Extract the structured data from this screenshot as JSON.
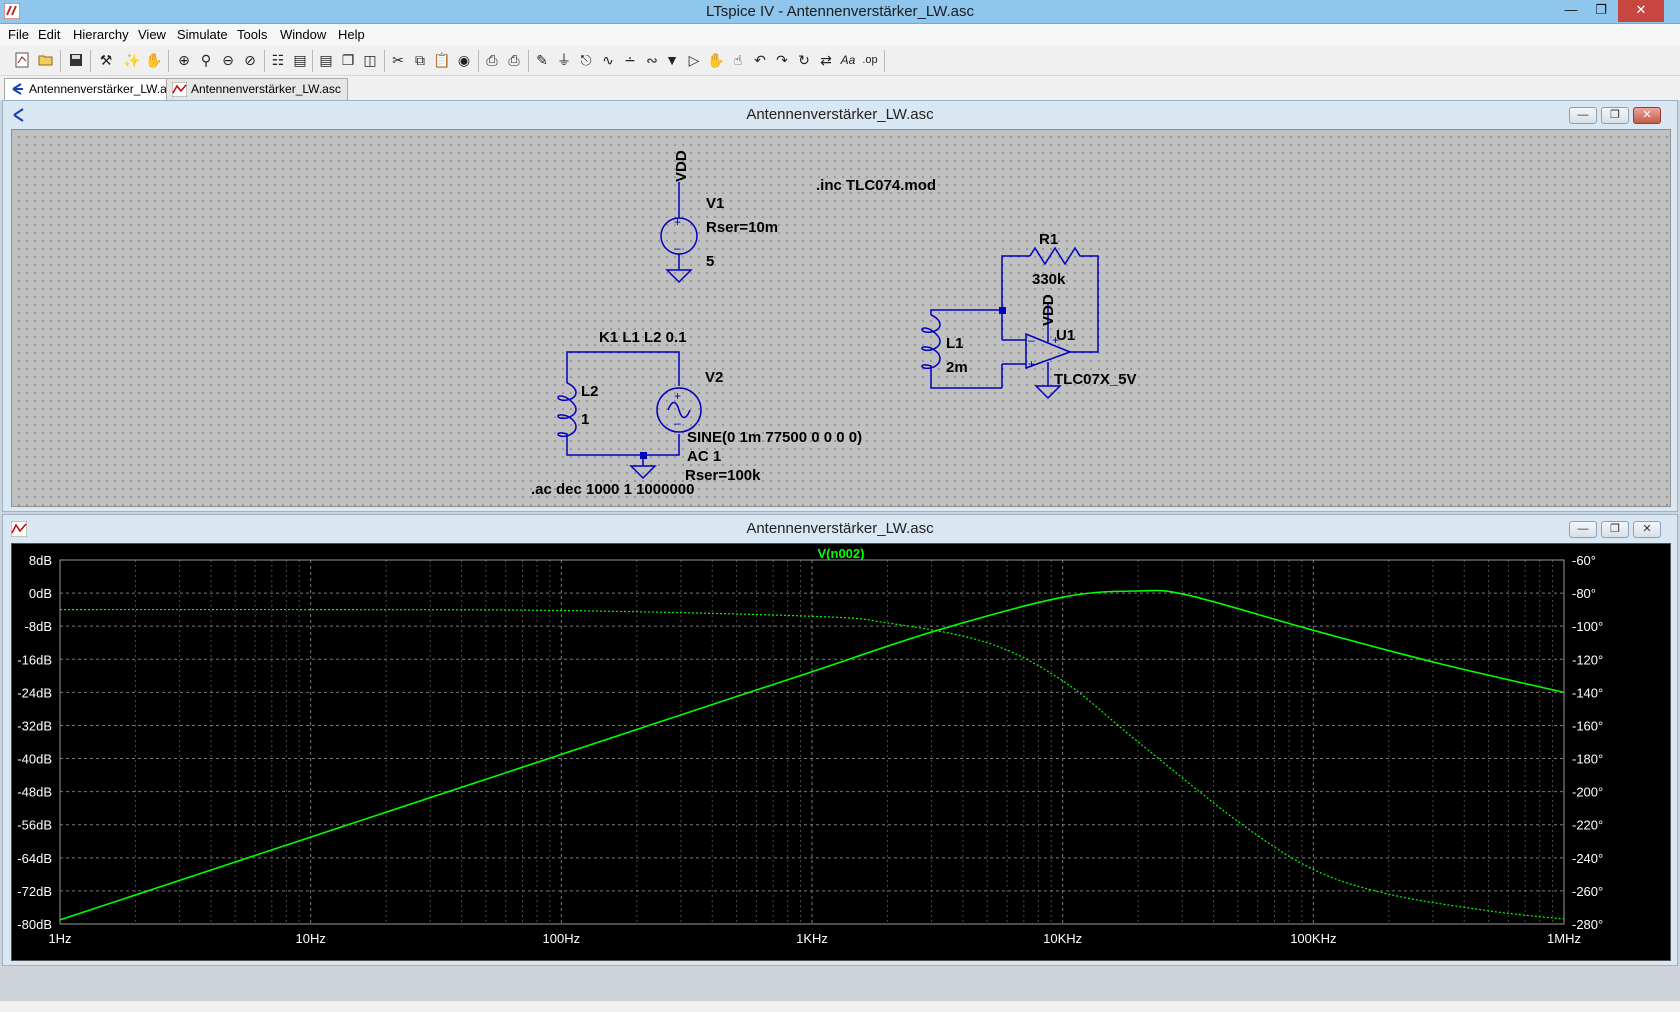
{
  "window": {
    "title": "LTspice IV - Antennenverstärker_LW.asc"
  },
  "menu": [
    "File",
    "Edit",
    "Hierarchy",
    "View",
    "Simulate",
    "Tools",
    "Window",
    "Help"
  ],
  "doc_tabs": [
    {
      "label": "Antennenverstärker_LW.asc",
      "kind": "schematic",
      "active": true
    },
    {
      "label": "Antennenverstärker_LW.asc",
      "kind": "waveform",
      "active": false
    }
  ],
  "schematic": {
    "title": "Antennenverstärker_LW.asc",
    "directive_inc": ".inc TLC074.mod",
    "directive_ac": ".ac dec 1000 1 1000000",
    "coupling": "K1 L1 L2 0.1",
    "vdd_label": "VDD",
    "v1": {
      "name": "V1",
      "param": "Rser=10m",
      "value": "5"
    },
    "v2": {
      "name": "V2",
      "source": "SINE(0 1m 77500 0 0 0 0)",
      "ac": "AC 1",
      "rser": "Rser=100k"
    },
    "l2": {
      "name": "L2",
      "value": "1"
    },
    "l1": {
      "name": "L1",
      "value": "2m"
    },
    "r1": {
      "name": "R1",
      "value": "330k"
    },
    "u1": {
      "name": "U1",
      "model": "TLC07X_5V"
    }
  },
  "waveform": {
    "title": "Antennenverstärker_LW.asc",
    "trace_label": "V(n002)",
    "trace_color": "#00ff00",
    "left_ticks": [
      "8dB",
      "0dB",
      "-8dB",
      "-16dB",
      "-24dB",
      "-32dB",
      "-40dB",
      "-48dB",
      "-56dB",
      "-64dB",
      "-72dB",
      "-80dB"
    ],
    "right_ticks": [
      "-60°",
      "-80°",
      "-100°",
      "-120°",
      "-140°",
      "-160°",
      "-180°",
      "-200°",
      "-220°",
      "-240°",
      "-260°",
      "-280°"
    ],
    "x_ticks": [
      "1Hz",
      "10Hz",
      "100Hz",
      "1KHz",
      "10KHz",
      "100KHz",
      "1MHz"
    ]
  },
  "chart_data": {
    "type": "line",
    "title": "V(n002)",
    "xlabel": "",
    "ylabel": "",
    "x_scale": "log",
    "xlim": [
      1,
      1000000
    ],
    "ylim": [
      -80,
      8
    ],
    "y2lim": [
      -280,
      -60
    ],
    "grid": true,
    "series": [
      {
        "name": "V(n002)",
        "axis": "magnitude_dB",
        "style": "solid",
        "x": [
          1,
          3.16,
          10,
          31.6,
          100,
          316,
          1000,
          3162,
          10000,
          20000,
          31623,
          100000,
          316228,
          1000000
        ],
        "y": [
          -79,
          -69,
          -59,
          -49,
          -39,
          -29,
          -19,
          -9,
          -1,
          0.5,
          -0.5,
          -9,
          -17,
          -24
        ]
      },
      {
        "name": "V(n002)",
        "axis": "phase_deg",
        "style": "dashed",
        "x": [
          1,
          10,
          100,
          1000,
          2000,
          5000,
          10000,
          20000,
          50000,
          100000,
          200000,
          500000,
          1000000
        ],
        "y": [
          -90,
          -90,
          -90.5,
          -94,
          -98,
          -110,
          -133,
          -170,
          -218,
          -247,
          -262,
          -272,
          -277
        ]
      }
    ]
  }
}
